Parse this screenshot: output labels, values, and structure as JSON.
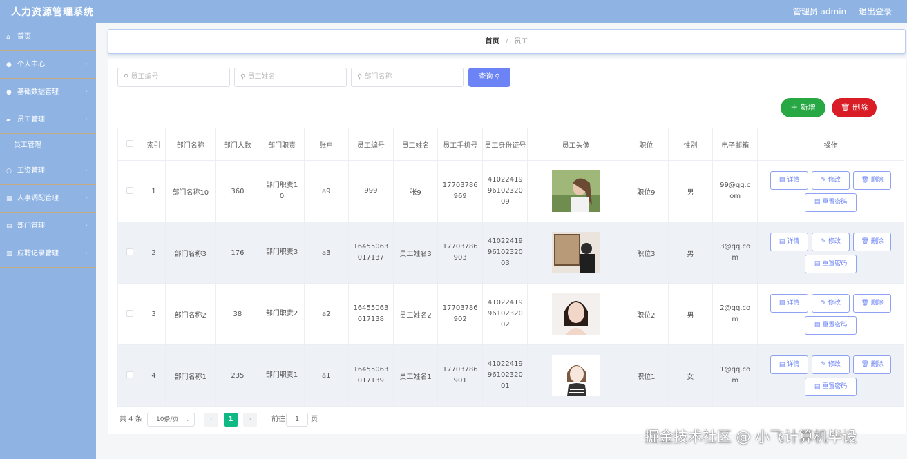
{
  "app": {
    "title": "人力资源管理系统",
    "user": "管理员 admin",
    "logout": "退出登录"
  },
  "sidebar": {
    "items": [
      {
        "label": "首页",
        "icon": "home-icon",
        "glyph": "⌂",
        "expandable": false
      },
      {
        "label": "个人中心",
        "icon": "user-icon",
        "glyph": "●",
        "expandable": true
      },
      {
        "label": "基础数据管理",
        "icon": "user-icon",
        "glyph": "●",
        "expandable": true
      },
      {
        "label": "员工管理",
        "icon": "folder-icon",
        "glyph": "▰",
        "expandable": true
      },
      {
        "label": "员工管理",
        "icon": "",
        "glyph": "",
        "expandable": false,
        "sub": true
      },
      {
        "label": "工资管理",
        "icon": "clock-icon",
        "glyph": "○",
        "expandable": true
      },
      {
        "label": "人事调配管理",
        "icon": "grid-icon",
        "glyph": "▦",
        "expandable": true
      },
      {
        "label": "部门管理",
        "icon": "briefcase-icon",
        "glyph": "▤",
        "expandable": true
      },
      {
        "label": "应聘记录管理",
        "icon": "chart-icon",
        "glyph": "▥",
        "expandable": true
      }
    ]
  },
  "breadcrumb": {
    "home": "首页",
    "separator": "/",
    "current": "员工"
  },
  "search": {
    "employee_no_placeholder": "员工编号",
    "employee_name_placeholder": "员工姓名",
    "dept_name_placeholder": "部门名称",
    "button": "查询"
  },
  "actions": {
    "add": "新增",
    "delete": "删除"
  },
  "table": {
    "headers": [
      "",
      "索引",
      "部门名称",
      "部门人数",
      "部门职责",
      "账户",
      "员工编号",
      "员工姓名",
      "员工手机号",
      "员工身份证号",
      "员工头像",
      "职位",
      "性别",
      "电子邮箱",
      "操作"
    ],
    "op_labels": {
      "detail": "详情",
      "edit": "修改",
      "delete": "删除",
      "reset": "重置密码"
    },
    "rows": [
      {
        "index": "1",
        "dept_name": "部门名称10",
        "dept_count": "360",
        "dept_duty": "部门职责10",
        "account": "a9",
        "emp_no": "999",
        "emp_name": "张9",
        "phone": "17703786969",
        "id_no": "410224199610232009",
        "avatar": "woman-profile-photo",
        "position": "职位9",
        "gender": "男",
        "email": "99@qq.com"
      },
      {
        "index": "2",
        "dept_name": "部门名称3",
        "dept_count": "176",
        "dept_duty": "部门职责3",
        "account": "a3",
        "emp_no": "16455063017137",
        "emp_name": "员工姓名3",
        "phone": "17703786903",
        "id_no": "410224199610232003",
        "avatar": "man-gallery-photo",
        "position": "职位3",
        "gender": "男",
        "email": "3@qq.com"
      },
      {
        "index": "3",
        "dept_name": "部门名称2",
        "dept_count": "38",
        "dept_duty": "部门职责2",
        "account": "a2",
        "emp_no": "16455063017138",
        "emp_name": "员工姓名2",
        "phone": "17703786902",
        "id_no": "410224199610232002",
        "avatar": "woman-portrait-photo",
        "position": "职位2",
        "gender": "男",
        "email": "2@qq.com"
      },
      {
        "index": "4",
        "dept_name": "部门名称1",
        "dept_count": "235",
        "dept_duty": "部门职责1",
        "account": "a1",
        "emp_no": "16455063017139",
        "emp_name": "员工姓名1",
        "phone": "17703786901",
        "id_no": "410224199610232001",
        "avatar": "cartoon-girl-illustration",
        "position": "职位1",
        "gender": "女",
        "email": "1@qq.com"
      }
    ]
  },
  "pager": {
    "total": "共 4 条",
    "page_size": "10条/页",
    "current_page": "1",
    "goto_label": "前往",
    "goto_value": "1",
    "page_suffix": "页"
  },
  "watermark": "掘金技术社区 @ 小飞计算机毕设",
  "colors": {
    "sidebar": "#8fb4e4",
    "primary": "#6b83f5",
    "add": "#27a844",
    "delete": "#d81d26",
    "pager_active": "#0fb984"
  }
}
